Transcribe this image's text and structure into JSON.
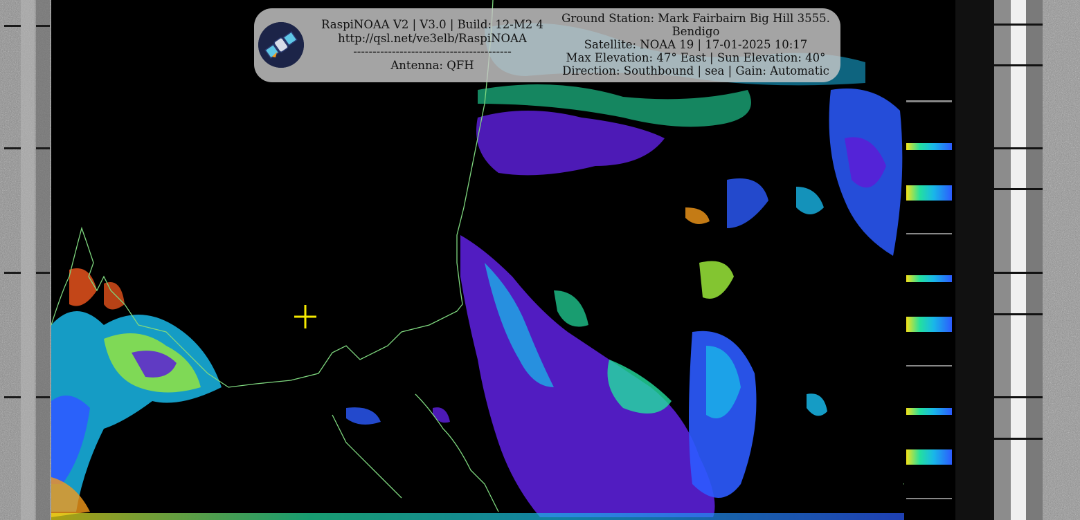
{
  "overlay": {
    "left_lines": [
      "RaspiNOAA V2 | V3.0 | Build: 12-M2 4",
      "http://qsl.net/ve3elb/RaspiNOAA",
      "-----------------------------------------",
      "Antenna: QFH"
    ],
    "right_lines": [
      "Ground Station: Mark Fairbairn Big Hill 3555.",
      "Bendigo",
      "Satellite: NOAA 19 | 17-01-2025 10:17",
      "Max Elevation: 47° East | Sun Elevation: 40°",
      "Direction: Southbound | sea | Gain: Automatic"
    ]
  },
  "colors": {
    "background": "#000000",
    "coastline": "#7fd87f",
    "crosshair": "#f5e900",
    "panel": "#c8c8c8",
    "palette": [
      "#5a1fd6",
      "#2c5bff",
      "#19b7e8",
      "#23e0a0",
      "#9ae83a",
      "#f5e21a",
      "#f59a1a",
      "#e5521c"
    ]
  },
  "icons": {
    "logo": "satellite-logo-icon",
    "marker": "crosshair-icon"
  }
}
